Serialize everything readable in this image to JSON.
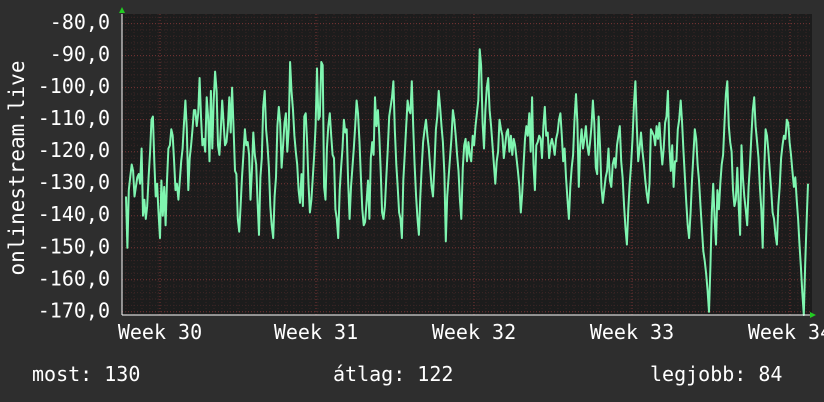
{
  "chart_data": {
    "type": "line",
    "ylabel": "onlinestream.live",
    "yticks": [
      "-80,0",
      "-90,0",
      "-100,0",
      "-110,0",
      "-120,0",
      "-130,0",
      "-140,0",
      "-150,0",
      "-160,0",
      "-170,0"
    ],
    "ylim": [
      -171,
      -77
    ],
    "xticks": [
      "Week 30",
      "Week 31",
      "Week 32",
      "Week 33",
      "Week 34"
    ],
    "grid": true,
    "colors": {
      "background": "#2e2e2e",
      "plot": "#1c1c1c",
      "grid": "#6a2f2f",
      "line": "#7ff5b0",
      "arrow": "#22cc22"
    },
    "series": [
      {
        "values": [
          -134,
          -150,
          -132,
          -128,
          -124,
          -126,
          -134,
          -131,
          -128,
          -127,
          -130,
          -119,
          -140,
          -135,
          -141,
          -137,
          -128,
          -120,
          -110,
          -109,
          -123,
          -134,
          -130,
          -139,
          -147,
          -129,
          -140,
          -131,
          -143,
          -129,
          -119,
          -118,
          -113,
          -115,
          -123,
          -132,
          -130,
          -135,
          -129,
          -123,
          -119,
          -111,
          -104,
          -113,
          -132,
          -122,
          -118,
          -113,
          -107,
          -107,
          -112,
          -108,
          -97,
          -109,
          -118,
          -116,
          -120,
          -103,
          -109,
          -123,
          -101,
          -119,
          -104,
          -95,
          -101,
          -118,
          -121,
          -113,
          -104,
          -111,
          -118,
          -117,
          -112,
          -103,
          -114,
          -100,
          -112,
          -126,
          -127,
          -141,
          -145,
          -137,
          -128,
          -121,
          -113,
          -118,
          -117,
          -121,
          -135,
          -126,
          -114,
          -121,
          -124,
          -136,
          -146,
          -128,
          -122,
          -106,
          -101,
          -113,
          -118,
          -125,
          -137,
          -143,
          -147,
          -134,
          -128,
          -112,
          -106,
          -111,
          -125,
          -118,
          -111,
          -108,
          -120,
          -113,
          -92,
          -101,
          -107,
          -115,
          -120,
          -124,
          -132,
          -136,
          -127,
          -137,
          -109,
          -108,
          -117,
          -130,
          -139,
          -135,
          -128,
          -121,
          -112,
          -94,
          -110,
          -109,
          -92,
          -93,
          -131,
          -135,
          -119,
          -112,
          -108,
          -115,
          -121,
          -122,
          -138,
          -141,
          -147,
          -132,
          -125,
          -119,
          -110,
          -114,
          -113,
          -129,
          -141,
          -131,
          -125,
          -119,
          -112,
          -104,
          -108,
          -117,
          -128,
          -138,
          -143,
          -142,
          -136,
          -129,
          -141,
          -122,
          -117,
          -121,
          -103,
          -112,
          -107,
          -115,
          -126,
          -139,
          -141,
          -137,
          -128,
          -119,
          -109,
          -106,
          -103,
          -98,
          -113,
          -124,
          -131,
          -139,
          -141,
          -147,
          -129,
          -121,
          -112,
          -104,
          -107,
          -108,
          -98,
          -112,
          -124,
          -134,
          -141,
          -146,
          -134,
          -125,
          -117,
          -113,
          -110,
          -115,
          -119,
          -125,
          -131,
          -134,
          -124,
          -113,
          -109,
          -101,
          -106,
          -112,
          -117,
          -127,
          -148,
          -134,
          -128,
          -122,
          -116,
          -107,
          -110,
          -115,
          -121,
          -126,
          -135,
          -141,
          -125,
          -118,
          -116,
          -123,
          -117,
          -121,
          -123,
          -115,
          -118,
          -112,
          -108,
          -104,
          -88,
          -93,
          -111,
          -119,
          -107,
          -100,
          -97,
          -107,
          -112,
          -118,
          -124,
          -130,
          -123,
          -120,
          -110,
          -113,
          -115,
          -122,
          -118,
          -114,
          -113,
          -120,
          -115,
          -121,
          -116,
          -118,
          -122,
          -126,
          -131,
          -139,
          -133,
          -124,
          -116,
          -112,
          -115,
          -108,
          -120,
          -103,
          -124,
          -132,
          -118,
          -117,
          -115,
          -116,
          -122,
          -112,
          -106,
          -115,
          -114,
          -122,
          -118,
          -116,
          -118,
          -121,
          -116,
          -114,
          -110,
          -108,
          -115,
          -123,
          -119,
          -128,
          -135,
          -141,
          -131,
          -125,
          -121,
          -110,
          -102,
          -111,
          -131,
          -118,
          -113,
          -119,
          -116,
          -112,
          -118,
          -121,
          -117,
          -112,
          -104,
          -111,
          -125,
          -127,
          -109,
          -118,
          -131,
          -136,
          -132,
          -128,
          -126,
          -119,
          -129,
          -131,
          -124,
          -122,
          -125,
          -118,
          -115,
          -112,
          -123,
          -128,
          -137,
          -144,
          -149,
          -138,
          -130,
          -124,
          -116,
          -105,
          -98,
          -112,
          -123,
          -119,
          -114,
          -120,
          -124,
          -129,
          -133,
          -136,
          -130,
          -113,
          -114,
          -115,
          -118,
          -112,
          -116,
          -111,
          -118,
          -124,
          -119,
          -111,
          -109,
          -101,
          -118,
          -126,
          -118,
          -131,
          -123,
          -123,
          -113,
          -110,
          -104,
          -111,
          -120,
          -128,
          -136,
          -143,
          -147,
          -139,
          -129,
          -121,
          -113,
          -116,
          -124,
          -129,
          -137,
          -144,
          -151,
          -154,
          -158,
          -163,
          -170,
          -156,
          -139,
          -130,
          -141,
          -149,
          -132,
          -138,
          -130,
          -124,
          -121,
          -111,
          -102,
          -98,
          -112,
          -117,
          -120,
          -132,
          -137,
          -135,
          -125,
          -137,
          -146,
          -118,
          -128,
          -134,
          -138,
          -143,
          -131,
          -124,
          -115,
          -107,
          -103,
          -112,
          -117,
          -122,
          -131,
          -138,
          -150,
          -127,
          -113,
          -115,
          -120,
          -126,
          -132,
          -139,
          -141,
          -146,
          -149,
          -137,
          -131,
          -122,
          -118,
          -115,
          -116,
          -110,
          -111,
          -117,
          -121,
          -126,
          -131,
          -128,
          -135,
          -141,
          -149,
          -156,
          -164,
          -172,
          -155,
          -142,
          -130
        ]
      }
    ]
  },
  "stats": {
    "current": "most: 130",
    "average": "átlag: 122",
    "max": "legjobb: 84"
  }
}
